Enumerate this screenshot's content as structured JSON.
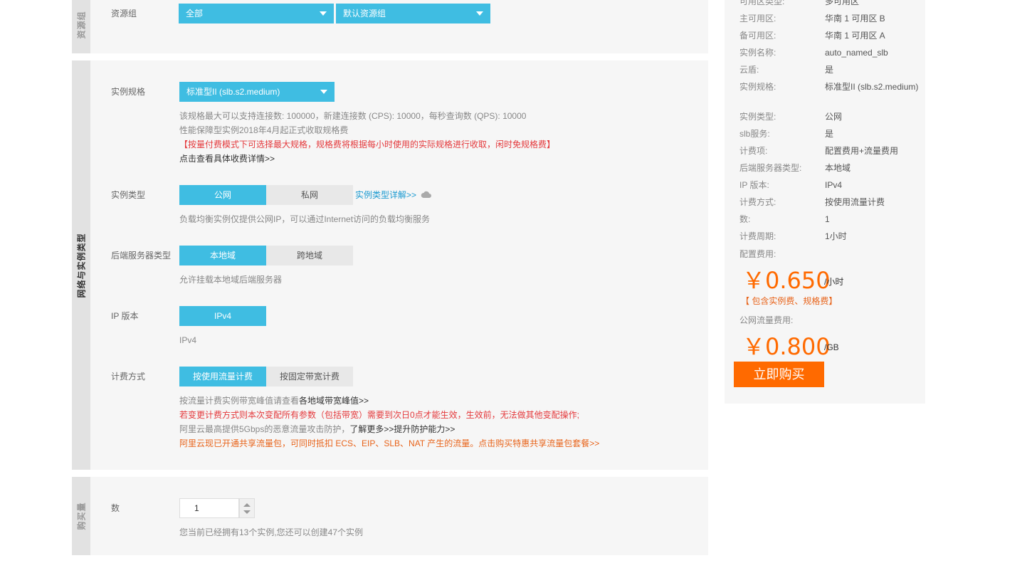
{
  "resource_group": {
    "side_label": "资源组",
    "label": "资源组",
    "dropdown1": "全部",
    "dropdown2": "默认资源组"
  },
  "network": {
    "side_label": "网络与实例类型",
    "spec": {
      "label": "实例规格",
      "value": "标准型II (slb.s2.medium)",
      "desc1": "该规格最大可以支持连接数: 100000，新建连接数 (CPS): 10000，每秒查询数 (QPS): 10000",
      "desc2": "性能保障型实例2018年4月起正式收取规格费",
      "warn": "【按量付费模式下可选择最大规格，规格费将根据每小时使用的实际规格进行收取，闲时免规格费】",
      "link": "点击查看具体收费详情>>"
    },
    "type": {
      "label": "实例类型",
      "opt_public": "公网",
      "opt_private": "私网",
      "detail_link": "实例类型详解>>",
      "desc": "负载均衡实例仅提供公网IP，可以通过Internet访问的负载均衡服务"
    },
    "backend": {
      "label": "后端服务器类型",
      "opt_local": "本地域",
      "opt_cross": "跨地域",
      "desc": "允许挂载本地域后端服务器"
    },
    "ip": {
      "label": "IP 版本",
      "opt": "IPv4",
      "desc": "IPv4"
    },
    "billing": {
      "label": "计费方式",
      "opt_traffic": "按使用流量计费",
      "opt_fixed": "按固定带宽计费",
      "line1_prefix": "按流量计费实例带宽峰值请查看",
      "line1_link": "各地域带宽峰值>>",
      "line2": "若变更计费方式则本次变配所有参数（包括带宽）需要到次日0点才能生效，生效前，无法做其他变配操作;",
      "line3_prefix": "阿里云最高提供5Gbps的恶意流量攻击防护，",
      "line3_link": "了解更多>>提升防护能力>>",
      "line4": "阿里云现已开通共享流量包，可同时抵扣 ECS、EIP、SLB、NAT 产生的流量。点击购买特惠共享流量包套餐>>"
    }
  },
  "purchase": {
    "side_label": "购买量",
    "label": "数",
    "quantity": "1",
    "desc": "您当前已经拥有13个实例,您还可以创建47个实例"
  },
  "summary": {
    "rows": [
      {
        "k": "可用区类型:",
        "v": "多可用区"
      },
      {
        "k": "主可用区:",
        "v": "华南 1 可用区 B"
      },
      {
        "k": "备可用区:",
        "v": "华南 1 可用区 A"
      },
      {
        "k": "实例名称:",
        "v": "auto_named_slb"
      },
      {
        "k": "云盾:",
        "v": "是"
      },
      {
        "k": "实例规格:",
        "v": "标准型II (slb.s2.medium)"
      },
      {
        "k": "实例类型:",
        "v": "公网"
      },
      {
        "k": "slb服务:",
        "v": "是"
      },
      {
        "k": "计费项:",
        "v": "配置费用+流量费用"
      },
      {
        "k": "后端服务器类型:",
        "v": "本地域"
      },
      {
        "k": "IP 版本:",
        "v": "IPv4"
      },
      {
        "k": "计费方式:",
        "v": "按使用流量计费"
      },
      {
        "k": "数:",
        "v": "1"
      },
      {
        "k": "计费周期:",
        "v": "1小时"
      }
    ],
    "config_fee_label": "配置费用:",
    "config_price": "￥0.650",
    "config_unit": "/小时",
    "config_note": "【 包含实例费、规格费】",
    "traffic_fee_label": "公网流量费用:",
    "traffic_price": "￥0.800",
    "traffic_unit": "/GB",
    "buy_label": "立即购买"
  },
  "colors": {
    "accent_blue": "#3fbde2",
    "orange": "#ff6a00",
    "red": "#e4393c"
  }
}
